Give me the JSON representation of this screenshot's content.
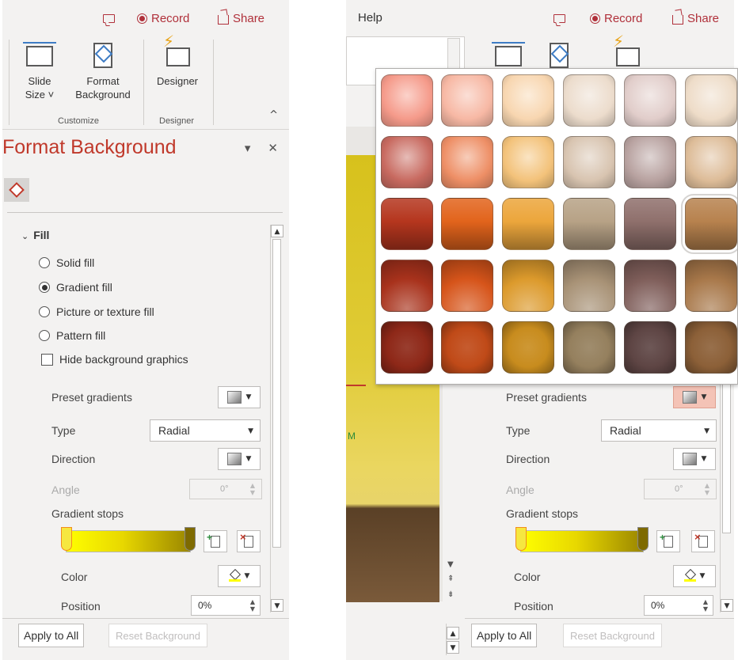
{
  "top": {
    "record_label": "Record",
    "share_label": "Share",
    "help_tab": "Help"
  },
  "ribbon": {
    "slide_size_label1": "Slide",
    "slide_size_label2": "Size ˅",
    "format_bg_label1": "Format",
    "format_bg_label2": "Background",
    "designer_label": "Designer",
    "group_customize": "Customize",
    "group_designer": "Designer"
  },
  "pane": {
    "title": "Format Background",
    "section": "Fill",
    "options": [
      {
        "label": "Solid fill",
        "selected": false
      },
      {
        "label": "Gradient fill",
        "selected": true
      },
      {
        "label": "Picture or texture fill",
        "selected": false
      },
      {
        "label": "Pattern fill",
        "selected": false
      }
    ],
    "hide_bg": "Hide background graphics",
    "preset_label": "Preset gradients",
    "type_label": "Type",
    "type_value": "Radial",
    "direction_label": "Direction",
    "angle_label": "Angle",
    "angle_value": "0°",
    "stops_label": "Gradient stops",
    "color_label": "Color",
    "position_label": "Position",
    "position_value": "0%",
    "apply_all": "Apply to All",
    "reset_bg": "Reset Background"
  },
  "slide": {
    "marker_text": "M"
  },
  "gallery": {
    "rows": [
      [
        "#f59a8a",
        "#f7b8a4",
        "#f8d6b0",
        "#ecdccc",
        "#e1cdca",
        "#eedcc8"
      ],
      [
        "#c86a60",
        "#ee8f66",
        "#f3c27a",
        "#d8c4b0",
        "#b8a2a0",
        "#ddbc98"
      ],
      [
        "#b5361e",
        "#e2641c",
        "#eca63c",
        "#b7a286",
        "#8f706c",
        "#b7824e"
      ],
      [
        "#a8321c",
        "#d6541a",
        "#dc9a2c",
        "#a89276",
        "#7f5e5a",
        "#a8784a"
      ],
      [
        "#8e2818",
        "#c04a18",
        "#c88c1e",
        "#95805e",
        "#5e4544",
        "#8c6038"
      ]
    ],
    "selected": [
      2,
      5
    ]
  }
}
